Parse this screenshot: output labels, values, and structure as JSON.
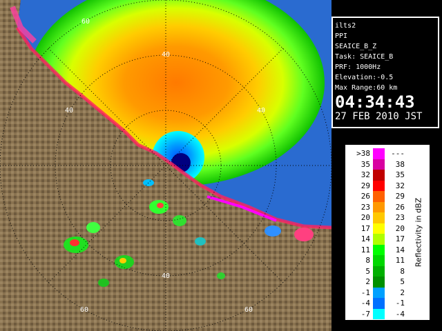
{
  "info": {
    "station": "ilts2",
    "scan_type": "PPI",
    "product": "SEAICE_B_Z",
    "task": "Task: SEAICE_B",
    "prf": "PRF: 1000Hz",
    "elevation": "Elevation:-0.5",
    "max_range": "Max Range:60 km",
    "time": "04:34:43",
    "date": "27 FEB 2010 JST"
  },
  "map": {
    "range_ring_labels": [
      "60",
      "40",
      "40",
      "40",
      "40",
      "60",
      "60"
    ]
  },
  "legend": {
    "unit": "Reflectivity in dBZ",
    "rows": [
      {
        "lo": ">38",
        "hi": "---",
        "color": "#ff00ff"
      },
      {
        "lo": "35",
        "hi": "38",
        "color": "#d800a0"
      },
      {
        "lo": "32",
        "hi": "35",
        "color": "#c00000"
      },
      {
        "lo": "29",
        "hi": "32",
        "color": "#ff0000"
      },
      {
        "lo": "26",
        "hi": "29",
        "color": "#ff6000"
      },
      {
        "lo": "23",
        "hi": "26",
        "color": "#ff9800"
      },
      {
        "lo": "20",
        "hi": "23",
        "color": "#ffc800"
      },
      {
        "lo": "17",
        "hi": "20",
        "color": "#ffff00"
      },
      {
        "lo": "14",
        "hi": "17",
        "color": "#b0ff00"
      },
      {
        "lo": "11",
        "hi": "14",
        "color": "#00ff00"
      },
      {
        "lo": "8",
        "hi": "11",
        "color": "#00d800"
      },
      {
        "lo": "5",
        "hi": "8",
        "color": "#00b000"
      },
      {
        "lo": "2",
        "hi": "5",
        "color": "#009000"
      },
      {
        "lo": "-1",
        "hi": "2",
        "color": "#00a0ff"
      },
      {
        "lo": "-4",
        "hi": "-1",
        "color": "#0070ff"
      },
      {
        "lo": "-7",
        "hi": "-4",
        "color": "#00ffff"
      }
    ]
  }
}
